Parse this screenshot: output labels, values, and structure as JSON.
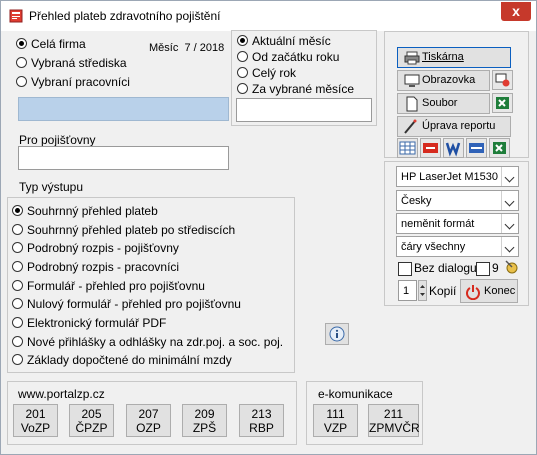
{
  "window": {
    "title": "Přehled plateb zdravotního pojištění",
    "close_glyph": "x"
  },
  "scope": {
    "options": [
      "Celá firma",
      "Vybraná střediska",
      "Vybraní pracovníci"
    ],
    "selected": 0,
    "month_label": "Měsíc",
    "month_value": "7 / 2018"
  },
  "period": {
    "options": [
      "Aktuální měsíc",
      "Od začátku roku",
      "Celý rok",
      "Za vybrané měsíce"
    ],
    "selected": 0
  },
  "insurers": {
    "label": "Pro pojišťovny",
    "value": ""
  },
  "output": {
    "label": "Typ výstupu",
    "options": [
      "Souhrnný přehled plateb",
      "Souhrnný přehled plateb po střediscích",
      "Podrobný rozpis - pojišťovny",
      "Podrobný rozpis - pracovníci",
      "Formulář - přehled pro pojišťovnu",
      "Nulový formulář - přehled pro pojišťovnu",
      "Elektronický formulář PDF",
      "Nové přihlášky a odhlášky na zdr.poj. a soc. poj.",
      "Základy dopočtené do minimální mzdy"
    ],
    "selected": 0
  },
  "actions": {
    "printer": "Tiskárna",
    "screen": "Obrazovka",
    "file": "Soubor",
    "edit_report": "Úprava reportu"
  },
  "export_icons": [
    "table-icon",
    "pdf-icon",
    "word-icon",
    "html-icon",
    "excel-icon"
  ],
  "combos": {
    "printer_name": "HP LaserJet M1530",
    "language": "Česky",
    "format": "neměnit formát",
    "lines": "čáry všechny"
  },
  "no_dialog": {
    "label": "Bez dialogu",
    "checked": false,
    "count": "9"
  },
  "copies": {
    "value": "1",
    "label": "Kopií"
  },
  "end_button": "Konec",
  "portal": {
    "label": "www.portalzp.cz",
    "buttons": [
      {
        "code": "201",
        "name": "VoZP"
      },
      {
        "code": "205",
        "name": "ČPZP"
      },
      {
        "code": "207",
        "name": "OZP"
      },
      {
        "code": "209",
        "name": "ZPŠ"
      },
      {
        "code": "213",
        "name": "RBP"
      }
    ]
  },
  "ecomm": {
    "label": "e-komunikace",
    "buttons": [
      {
        "code": "111",
        "name": "VZP"
      },
      {
        "code": "211",
        "name": "ZPMVČR"
      }
    ]
  },
  "colors": {
    "selection_field": "#b9d1ea",
    "close": "#c6392b",
    "accent": "#0b5fc0"
  }
}
